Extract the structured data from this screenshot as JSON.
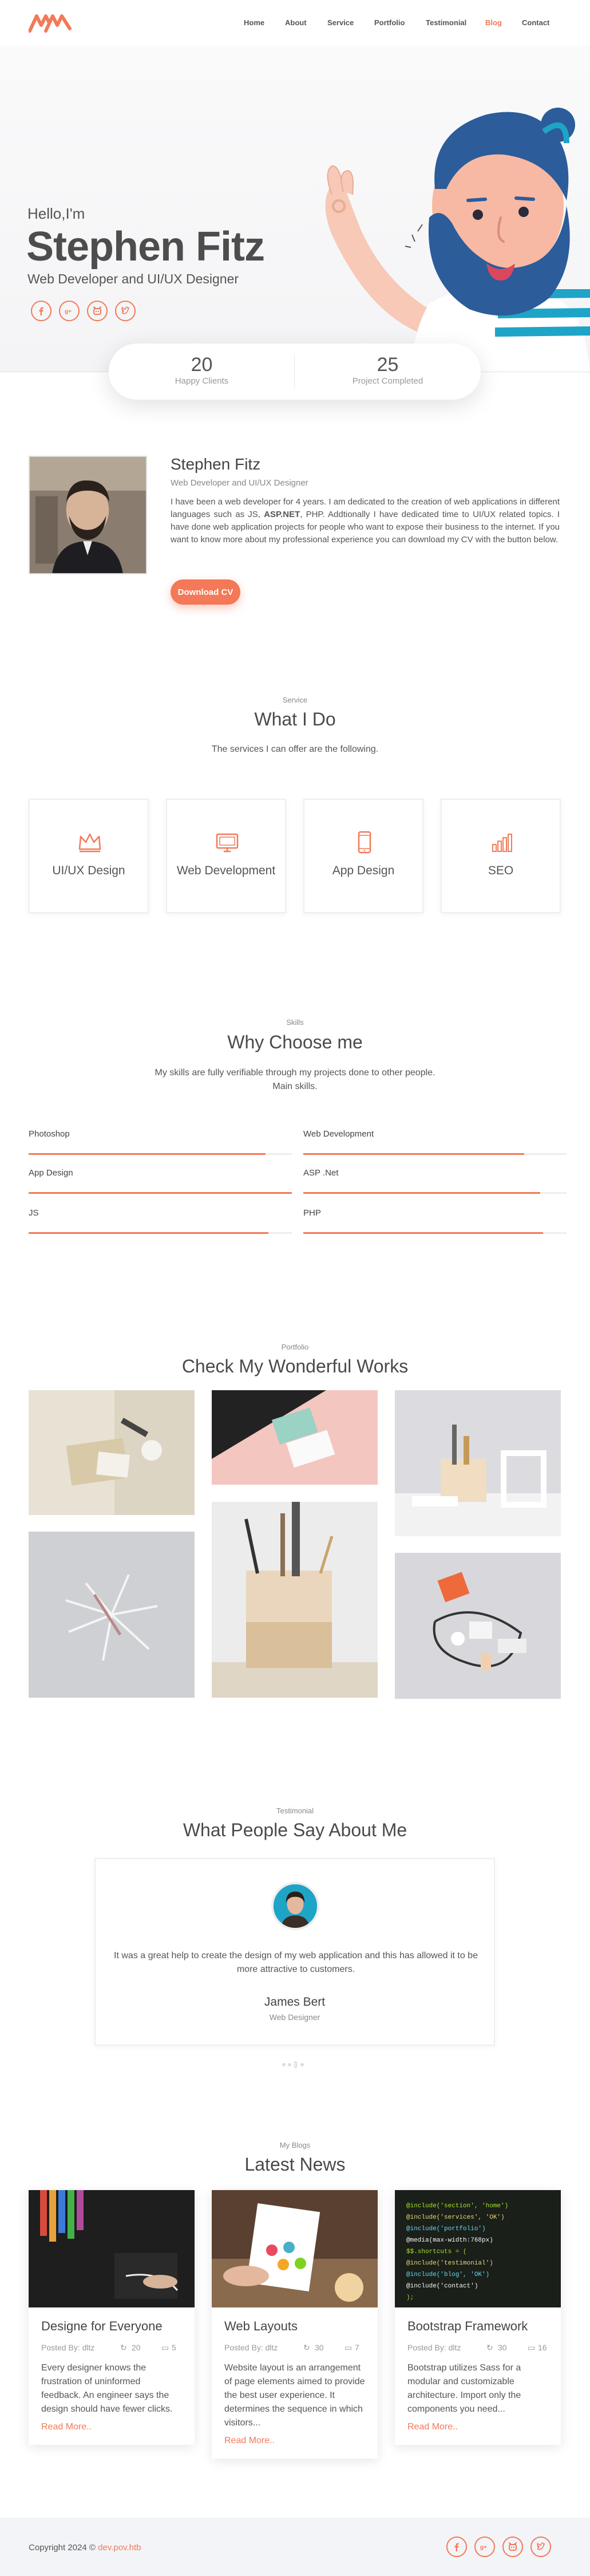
{
  "nav": {
    "links": [
      "Home",
      "About",
      "Service",
      "Portfolio",
      "Testimonial",
      "Blog",
      "Contact"
    ],
    "active_index": 5,
    "accent": "#f37958"
  },
  "hero": {
    "greeting": "Hello,I'm",
    "name": "Stephen Fitz",
    "role": "Web Developer and UI/UX Designer",
    "socials": [
      "facebook-icon",
      "google-plus-icon",
      "github-icon",
      "twitter-icon"
    ]
  },
  "stats": [
    {
      "value": "20",
      "label": "Happy Clients"
    },
    {
      "value": "25",
      "label": "Project Completed"
    }
  ],
  "about": {
    "title": "Stephen Fitz",
    "subtitle": "Web Developer and UI/UX Designer",
    "text_parts": [
      "I have been a web developer for 4 years. I am dedicated to the creation of web applications in different languages such as JS, ",
      "ASP.NET",
      ", PHP. Addtionally I have dedicated time to UI/UX related topics. I have done web application projects for people who want to expose their business to the internet. If you want to know more about my professional experience you can download my CV with the button below."
    ],
    "button": "Download CV"
  },
  "service": {
    "kicker": "Service",
    "title": "What I Do",
    "desc": "The services I can offer are the following.",
    "items": [
      {
        "label": "UI/UX Design",
        "icon": "crown-icon"
      },
      {
        "label": "Web Development",
        "icon": "monitor-icon"
      },
      {
        "label": "App Design",
        "icon": "mobile-icon"
      },
      {
        "label": "SEO",
        "icon": "bar-chart-icon"
      }
    ]
  },
  "skills": {
    "kicker": "Skills",
    "title": "Why Choose me",
    "desc_line1": "My skills are fully verifiable through my projects done to other people.",
    "desc_line2": "Main skills.",
    "items": [
      {
        "label": "Photoshop",
        "level": 0.9
      },
      {
        "label": "Web Development",
        "level": 0.84
      },
      {
        "label": "App Design",
        "level": 1.0
      },
      {
        "label": "ASP .Net",
        "level": 0.9
      },
      {
        "label": "JS",
        "level": 0.91
      },
      {
        "label": "PHP",
        "level": 0.91
      }
    ]
  },
  "portfolio": {
    "kicker": "Portfolio",
    "title": "Check My Wonderful Works"
  },
  "testimonial": {
    "kicker": "Testimonial",
    "title": "What People Say About Me",
    "quote": "It was a great help to create the design of my web application and this has allowed it to be more attractive to customers.",
    "name": "James Bert",
    "role": "Web Designer"
  },
  "blog": {
    "kicker": "My Blogs",
    "title": "Latest News",
    "posts": [
      {
        "title": "Designe for Everyone",
        "meta": "Posted By: dltz",
        "likes": "20",
        "comments": "5",
        "text": "Every designer knows the frustration of uninformed feedback. An engineer says the design should have fewer clicks.",
        "more": "Read More.."
      },
      {
        "title": "Web Layouts",
        "meta": "Posted By: dltz",
        "likes": "30",
        "comments": "7",
        "text": "Website layout is an arrangement of page elements aimed to provide the best user experience. It determines the sequence in which visitors...",
        "more": "Read More.."
      },
      {
        "title": "Bootstrap Framework",
        "meta": "Posted By: dltz",
        "likes": "30",
        "comments": "16",
        "text": "Bootstrap utilizes Sass for a modular and customizable architecture. Import only the components you need...",
        "more": "Read More.."
      }
    ]
  },
  "footer": {
    "copy": "Copyright 2024 © ",
    "link": "dev.pov.htb"
  }
}
